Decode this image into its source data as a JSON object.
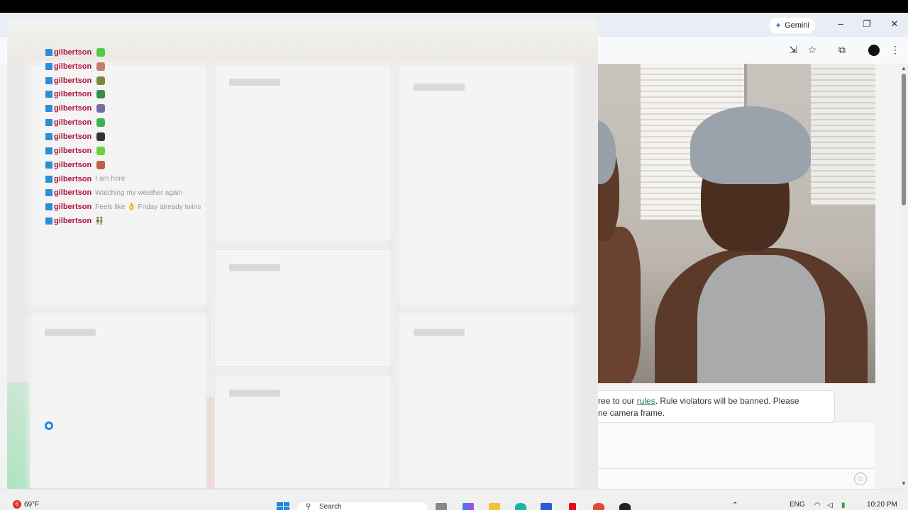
{
  "browser": {
    "gemini_label": "Gemini",
    "window_controls": [
      "minimize",
      "restore",
      "close"
    ],
    "toolbar_icons": [
      "install-app-icon",
      "star-icon",
      "split-view-icon",
      "profile-icon",
      "more-icon"
    ]
  },
  "chat": {
    "username": "gilbertson",
    "messages": [
      {
        "user": "gilbertson",
        "text": "",
        "emote_color": "#54c84b"
      },
      {
        "user": "gilbertson",
        "text": "",
        "emote_color": "#c77b6b"
      },
      {
        "user": "gilbertson",
        "text": "",
        "emote_color": "#7a8a3a"
      },
      {
        "user": "gilbertson",
        "text": "",
        "emote_color": "#3a8a4a"
      },
      {
        "user": "gilbertson",
        "text": "",
        "emote_color": "#6f6fa8"
      },
      {
        "user": "gilbertson",
        "text": "",
        "emote_color": "#3fb34f"
      },
      {
        "user": "gilbertson",
        "text": "",
        "emote_color": "#333333"
      },
      {
        "user": "gilbertson",
        "text": "",
        "emote_color": "#6fcf3f"
      },
      {
        "user": "gilbertson",
        "text": "",
        "emote_color": "#b8604a"
      },
      {
        "user": "gilbertson",
        "text": "I am here",
        "emote_color": ""
      },
      {
        "user": "gilbertson",
        "text": "Watching my weather again",
        "emote_color": ""
      },
      {
        "user": "gilbertson",
        "text": "Feels like 👌 Friday already twins",
        "emote_color": ""
      },
      {
        "user": "gilbertson",
        "text": "👬",
        "emote_color": ""
      }
    ]
  },
  "rules_notice": {
    "prefix": "ree to our ",
    "link": "rules",
    "suffix": ". Rule violators will be banned. Please",
    "line2": "ne camera frame."
  },
  "taskbar": {
    "weather_temp": "69°F",
    "weather_badge": "6",
    "search_placeholder": "Search",
    "language": "ENG",
    "time": "10:20 PM"
  }
}
